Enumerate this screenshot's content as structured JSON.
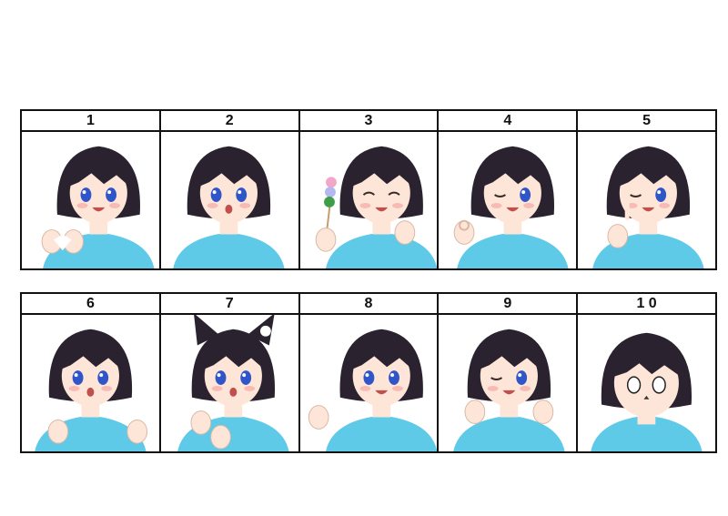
{
  "panels": [
    {
      "number": "1",
      "icon": "heart-hands-girl"
    },
    {
      "number": "2",
      "icon": "surprised-blush-girl"
    },
    {
      "number": "3",
      "icon": "dango-smiling-girl"
    },
    {
      "number": "4",
      "icon": "ok-sign-wink-girl"
    },
    {
      "number": "5",
      "icon": "wink-finger-cheek-girl"
    },
    {
      "number": "6",
      "icon": "flustered-hands-up-girl"
    },
    {
      "number": "7",
      "icon": "cat-ears-paw-girl"
    },
    {
      "number": "8",
      "icon": "waving-girl"
    },
    {
      "number": "9",
      "icon": "wink-cheek-poke-girl"
    },
    {
      "number": "1 0",
      "icon": "chibi-blank-eyes-girl"
    }
  ],
  "colors": {
    "hair": "#2b2230",
    "skin": "#fde6d8",
    "shirt": "#5fc9e8",
    "eyes": "#2f55c8",
    "blush": "#f4a7a7",
    "border": "#111111"
  }
}
